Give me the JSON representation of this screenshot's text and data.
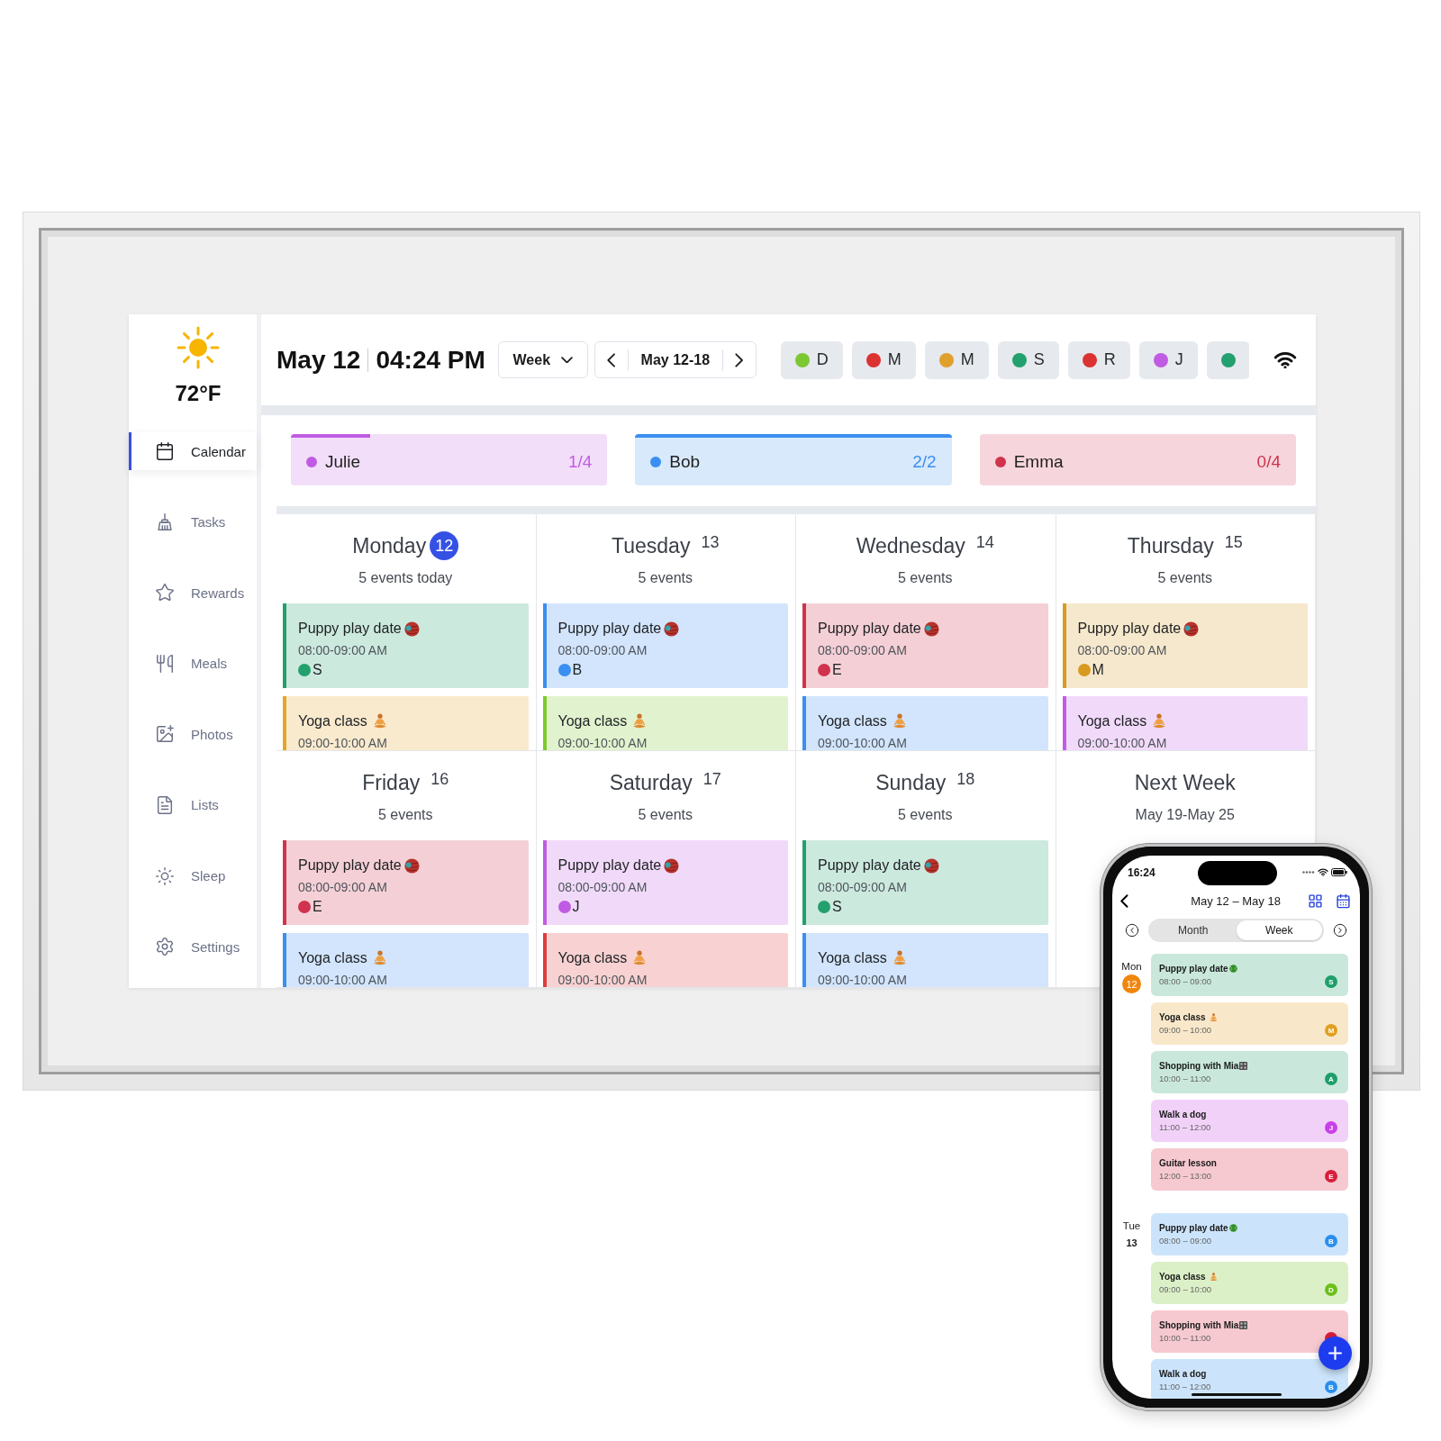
{
  "weather": {
    "temperature": "72°F"
  },
  "sidebar": {
    "items": [
      {
        "label": "Calendar",
        "selected": true
      },
      {
        "label": "Tasks",
        "selected": false
      },
      {
        "label": "Rewards",
        "selected": false
      },
      {
        "label": "Meals",
        "selected": false
      },
      {
        "label": "Photos",
        "selected": false
      },
      {
        "label": "Lists",
        "selected": false
      },
      {
        "label": "Sleep",
        "selected": false
      },
      {
        "label": "Settings",
        "selected": false
      }
    ]
  },
  "header": {
    "date": "May 12",
    "time": "04:24 PM",
    "view": "Week",
    "range": "May 12-18"
  },
  "filters": [
    {
      "label": "D",
      "color": "#7cc832"
    },
    {
      "label": "M",
      "color": "#dc3232"
    },
    {
      "label": "M",
      "color": "#e0a02c"
    },
    {
      "label": "S",
      "color": "#23a06e"
    },
    {
      "label": "R",
      "color": "#dc3232"
    },
    {
      "label": "J",
      "color": "#c05ce3"
    },
    {
      "color": "#23a06e"
    }
  ],
  "members": [
    {
      "name": "Julie",
      "color": "#c05ce3",
      "count": "1/4",
      "level": 0.25
    },
    {
      "name": "Bob",
      "color": "#3b8ff0",
      "count": "2/2",
      "level": 1
    },
    {
      "name": "Emma",
      "color": "#d0334e",
      "count": "0/4",
      "level": 0
    }
  ],
  "days": [
    {
      "name": "Monday",
      "date": "12",
      "today": true,
      "summary": "5 events today",
      "events": [
        {
          "kind": "yarn",
          "title": "Puppy play date",
          "time": "08:00-09:00 AM",
          "person": "S",
          "color": "#23a06e"
        },
        {
          "kind": "yoga",
          "title": "Yoga class",
          "time": "09:00-10:00 AM",
          "color": "#e3a52a"
        }
      ]
    },
    {
      "name": "Tuesday",
      "date": "13",
      "today": false,
      "summary": "5 events",
      "events": [
        {
          "kind": "yarn",
          "title": "Puppy play date",
          "time": "08:00-09:00 AM",
          "person": "B",
          "color": "#3b8ff0"
        },
        {
          "kind": "yoga",
          "title": "Yoga class",
          "time": "09:00-10:00 AM",
          "color": "#7ccb2c"
        }
      ]
    },
    {
      "name": "Wednesday",
      "date": "14",
      "today": false,
      "summary": "5 events",
      "events": [
        {
          "kind": "yarn",
          "title": "Puppy play date",
          "time": "08:00-09:00 AM",
          "person": "E",
          "color": "#d0334e"
        },
        {
          "kind": "yoga",
          "title": "Yoga class",
          "time": "09:00-10:00 AM",
          "color": "#3b8ff0"
        }
      ]
    },
    {
      "name": "Thursday",
      "date": "15",
      "today": false,
      "summary": "5 events",
      "events": [
        {
          "kind": "yarn",
          "title": "Puppy play date",
          "time": "08:00-09:00 AM",
          "person": "M",
          "color": "#d99a22"
        },
        {
          "kind": "yoga",
          "title": "Yoga class",
          "time": "09:00-10:00 AM",
          "color": "#c05ce3"
        }
      ]
    },
    {
      "name": "Friday",
      "date": "16",
      "today": false,
      "summary": "5 events",
      "events": [
        {
          "kind": "yarn",
          "title": "Puppy play date",
          "time": "08:00-09:00 AM",
          "person": "E",
          "color": "#d0334e"
        },
        {
          "kind": "yoga",
          "title": "Yoga class",
          "time": "09:00-10:00 AM",
          "color": "#3b8ff0"
        }
      ]
    },
    {
      "name": "Saturday",
      "date": "17",
      "today": false,
      "summary": "5 events",
      "events": [
        {
          "kind": "yarn",
          "title": "Puppy play date",
          "time": "08:00-09:00 AM",
          "person": "J",
          "color": "#c05ce3"
        },
        {
          "kind": "yoga",
          "title": "Yoga class",
          "time": "09:00-10:00 AM",
          "color": "#e03c3c"
        }
      ]
    },
    {
      "name": "Sunday",
      "date": "18",
      "today": false,
      "summary": "5 events",
      "events": [
        {
          "kind": "yarn",
          "title": "Puppy play date",
          "time": "08:00-09:00 AM",
          "person": "S",
          "color": "#23a06e"
        },
        {
          "kind": "yoga",
          "title": "Yoga class",
          "time": "09:00-10:00 AM",
          "color": "#3b8ff0"
        }
      ]
    }
  ],
  "next_week": {
    "title": "Next Week",
    "range": "May 19-May 25"
  },
  "phone": {
    "status_time": "16:24",
    "title": "May 12 – May 18",
    "segments": [
      {
        "label": "Month",
        "selected": false
      },
      {
        "label": "Week",
        "selected": true
      }
    ],
    "days": [
      {
        "weekday": "Mon",
        "date": "12",
        "today": true,
        "events": [
          {
            "kind": "tennis",
            "title": "Puppy play date",
            "time": "08:00 – 09:00",
            "initial": "S",
            "color": "#1e9e6a"
          },
          {
            "kind": "yoga",
            "title": "Yoga class",
            "time": "09:00 – 10:00",
            "initial": "M",
            "color": "#e0a020"
          },
          {
            "kind": "shopping",
            "title": "Shopping with Mia",
            "time": "10:00 – 11:00",
            "initial": "A",
            "color": "#1e9e6a"
          },
          {
            "kind": "plain",
            "title": "Walk a dog",
            "time": "11:00 – 12:00",
            "initial": "J",
            "color": "#c93fe8"
          },
          {
            "kind": "plain",
            "title": "Guitar lesson",
            "time": "12:00 – 13:00",
            "initial": "E",
            "color": "#d81e3a"
          }
        ]
      },
      {
        "weekday": "Tue",
        "date": "13",
        "today": false,
        "events": [
          {
            "kind": "tennis",
            "title": "Puppy play date",
            "time": "08:00 – 09:00",
            "initial": "B",
            "color": "#2a8ef0"
          },
          {
            "kind": "yoga",
            "title": "Yoga class",
            "time": "09:00 – 10:00",
            "initial": "D",
            "color": "#6cc01a"
          },
          {
            "kind": "shopping",
            "title": "Shopping with Mia",
            "time": "10:00 – 11:00",
            "color": "#d81e3a"
          },
          {
            "kind": "plain",
            "title": "Walk a dog",
            "time": "11:00 – 12:00",
            "initial": "B",
            "color": "#2a8ef0"
          }
        ]
      }
    ]
  }
}
